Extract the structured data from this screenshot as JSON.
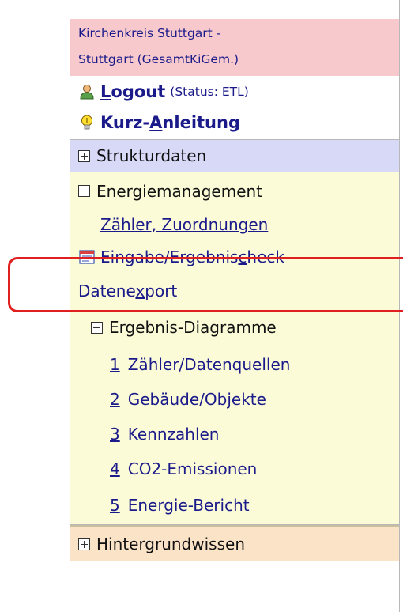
{
  "org": {
    "line1": "Kirchenkreis Stuttgart -",
    "line2": "Stuttgart (GesamtKiGem.)"
  },
  "logout": {
    "label_first": "L",
    "label_rest": "ogout",
    "status": "(Status: ETL)",
    "icon": "user-icon"
  },
  "anleitung": {
    "label_pre": "Kurz-",
    "label_accel": "A",
    "label_rest": "nleitung",
    "icon": "lightbulb-icon"
  },
  "sections": {
    "strukturdaten": "Strukturdaten",
    "energiemanagement": "Energiemanagement",
    "hintergrundwissen": "Hintergrundwissen"
  },
  "energie_items": {
    "zaehler": "Zähler, Zuordnungen",
    "eingabe_pre": "Eingabe/Ergebnis",
    "eingabe_accel": "c",
    "eingabe_rest": "heck",
    "export_pre": "Datene",
    "export_accel": "x",
    "export_rest": "port"
  },
  "diagramme": {
    "title": "Ergebnis-Diagramme",
    "items": [
      {
        "num": "1",
        "label": "Zähler/Datenquellen"
      },
      {
        "num": "2",
        "label": "Gebäude/Objekte"
      },
      {
        "num": "3",
        "label": "Kennzahlen"
      },
      {
        "num": "4",
        "label": "CO2-Emissionen"
      },
      {
        "num": "5",
        "label": "Energie-Bericht"
      }
    ]
  },
  "colors": {
    "header_bg": "#f7c8cc",
    "struktur_bg": "#d7d9f7",
    "energie_bg": "#fbfbd8",
    "hintergrund_bg": "#fbe3c8",
    "link": "#1a1a8a",
    "highlight": "#e02020"
  }
}
